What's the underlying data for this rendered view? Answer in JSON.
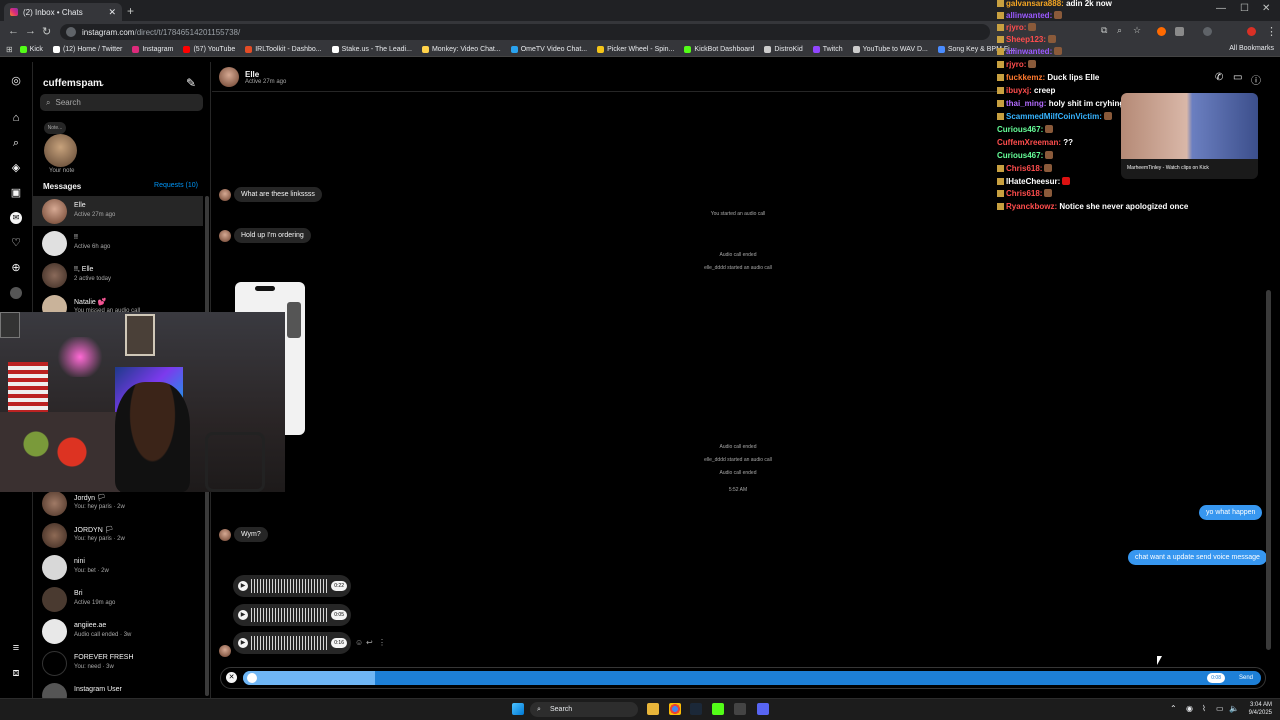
{
  "browser": {
    "tab_title": "(2) Inbox • Chats",
    "url_domain": "instagram.com",
    "url_path": "/direct/t/17846514201155738/",
    "bookmarks": [
      {
        "label": "Kick",
        "color": "#53fc18"
      },
      {
        "label": "(12) Home / Twitter",
        "color": "#ffffff"
      },
      {
        "label": "Instagram",
        "color": "#dd2a7b"
      },
      {
        "label": "(57) YouTube",
        "color": "#ff0000"
      },
      {
        "label": "IRLToolkit - Dashbo...",
        "color": "#e34c26"
      },
      {
        "label": "Stake.us - The Leadi...",
        "color": "#ffffff"
      },
      {
        "label": "Monkey: Video Chat...",
        "color": "#ffd24a"
      },
      {
        "label": "OmeTV Video Chat...",
        "color": "#2aa3ef"
      },
      {
        "label": "Picker Wheel - Spin...",
        "color": "#f5c518"
      },
      {
        "label": "KickBot Dashboard",
        "color": "#53fc18"
      },
      {
        "label": "DistroKid",
        "color": "#cccccc"
      },
      {
        "label": "Twitch",
        "color": "#9146ff"
      },
      {
        "label": "YouTube to WAV D...",
        "color": "#cccccc"
      },
      {
        "label": "Song Key & BPM Fi...",
        "color": "#4a8cff"
      }
    ],
    "all_bookmarks": "All Bookmarks"
  },
  "inbox": {
    "username": "cuffemspam",
    "search_placeholder": "Search",
    "note_bubble": "Note...",
    "your_note": "Your note",
    "messages_heading": "Messages",
    "requests": "Requests (10)",
    "conversations": [
      {
        "name": "Elle",
        "sub": "Active 27m ago",
        "active": true,
        "color": "#b98a76"
      },
      {
        "name": "!!",
        "sub": "Active 6h ago",
        "active": false,
        "color": "#e0e0e0"
      },
      {
        "name": "!!, Elle",
        "sub": "2 active today",
        "active": false,
        "color": "#8a6a5a"
      },
      {
        "name": "Natalie 💕",
        "sub": "You missed an audio call",
        "active": false,
        "color": "#c9b39a"
      },
      {
        "name": "Jordyn 🏳",
        "sub": "You: hey paris · 2w",
        "active": false,
        "color": "#7d5d4d"
      },
      {
        "name": "JORDYN 🏳",
        "sub": "You: hey paris · 2w",
        "active": false,
        "color": "#6e5242"
      },
      {
        "name": "nini",
        "sub": "You: bet · 2w",
        "active": false,
        "color": "#d8d8d8"
      },
      {
        "name": "Bri",
        "sub": "Active 19m ago",
        "active": false,
        "color": "#4a3a30"
      },
      {
        "name": "angiiee.ae",
        "sub": "Audio call ended · 3w",
        "active": false,
        "color": "#e8e8e8"
      },
      {
        "name": "FOREVER FRESH",
        "sub": "You: need · 3w",
        "active": false,
        "color": "#000000"
      },
      {
        "name": "Instagram User",
        "sub": "",
        "active": false,
        "color": "#555555"
      }
    ]
  },
  "thread": {
    "name": "Elle",
    "status": "Active 27m ago",
    "incoming": [
      "What are these linkssss",
      "Hold up I'm ordering",
      "Wym?"
    ],
    "system": [
      "You started an audio call",
      "Audio call ended",
      "elle_dddd started an audio call",
      "Audio call ended",
      "elle_dddd started an audio call",
      "Audio call ended",
      "5:52 AM"
    ],
    "outgoing": [
      "yo what happen",
      "chat want a update send voice message"
    ],
    "voice_notes": [
      {
        "duration": "0:22"
      },
      {
        "duration": "0:05"
      },
      {
        "duration": "0:16"
      }
    ],
    "recording": {
      "time": "0:08",
      "progress": 0.13,
      "send": "Send"
    }
  },
  "stream_chat": {
    "lines": [
      {
        "user": "galvansara888:",
        "text": "adin 2k now",
        "color": "#f5a623"
      },
      {
        "user": "allinwanted:",
        "text": "",
        "color": "#9b59ff"
      },
      {
        "user": "rjyro:",
        "text": "",
        "color": "#ff4d4d"
      },
      {
        "user": "Sheep123:",
        "text": "",
        "color": "#ff4d4d"
      },
      {
        "user": "allinwanted:",
        "text": "",
        "color": "#9b59ff"
      },
      {
        "user": "rjyro:",
        "text": "",
        "color": "#ff4d4d"
      },
      {
        "user": "fuckkemz:",
        "text": "Duck lips Elle",
        "color": "#ff7a2f"
      },
      {
        "user": "ibuyxj:",
        "text": "creep",
        "color": "#ff4d4d"
      },
      {
        "user": "thai_ming:",
        "text": "holy shit im cryhing how do u make that sound",
        "color": "#b36bff"
      },
      {
        "user": "ScammedMilfCoinVictim:",
        "text": "",
        "color": "#37b4ff"
      },
      {
        "user": "Curious467:",
        "text": "",
        "color": "#66ff99"
      },
      {
        "user": "CuffemXreeman:",
        "text": "??",
        "color": "#ff4d4d"
      },
      {
        "user": "Curious467:",
        "text": "",
        "color": "#66ff99"
      },
      {
        "user": "Chris618:",
        "text": "",
        "color": "#ff4d4d"
      },
      {
        "user": "IHateCheesur:",
        "text": "",
        "color": "#ffffff"
      },
      {
        "user": "Chris618:",
        "text": "",
        "color": "#ff4d4d"
      },
      {
        "user": "Ryanckbowz:",
        "text": "Notice she never apologized once",
        "color": "#ff4d4d"
      }
    ],
    "popup_caption": "MarheemTinley - Watch clips on Kick"
  },
  "taskbar": {
    "search": "Search",
    "time": "3:04 AM",
    "date": "9/4/2025"
  }
}
